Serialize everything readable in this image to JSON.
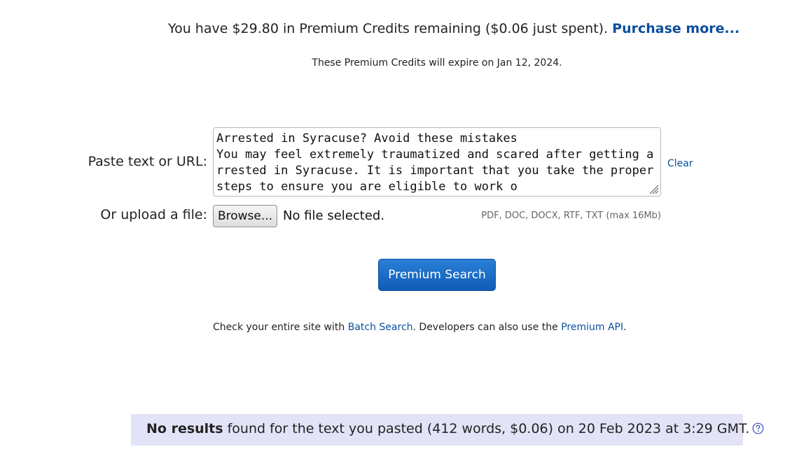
{
  "credits": {
    "message": "You have $29.80 in Premium Credits remaining ($0.06 just spent).",
    "purchase_link": "Purchase more...",
    "expiry": "These Premium Credits will expire on Jan 12, 2024."
  },
  "form": {
    "paste_label": "Paste text or URL:",
    "text_value": "Arrested in Syracuse? Avoid these mistakes\nYou may feel extremely traumatized and scared after getting arrested in Syracuse. It is important that you take the proper steps to ensure you are eligible to work o",
    "clear_label": "Clear",
    "upload_label": "Or upload a file:",
    "browse_label": "Browse...",
    "file_status": "No file selected.",
    "file_types": "PDF, DOC, DOCX, RTF, TXT (max 16Mb)",
    "submit_label": "Premium Search"
  },
  "batch": {
    "prefix": "Check your entire site with ",
    "batch_link": "Batch Search",
    "middle": ". Developers can also use the ",
    "api_link": "Premium API",
    "suffix": "."
  },
  "results": {
    "status": "No results",
    "details": " found for the text you pasted (412 words, $0.06) on 20 Feb 2023 at 3:29 GMT.",
    "help_icon": "question-circle-icon"
  },
  "colors": {
    "link": "#0b4f9c",
    "button": "#1565c0",
    "results_bg": "#e3e3f7"
  }
}
